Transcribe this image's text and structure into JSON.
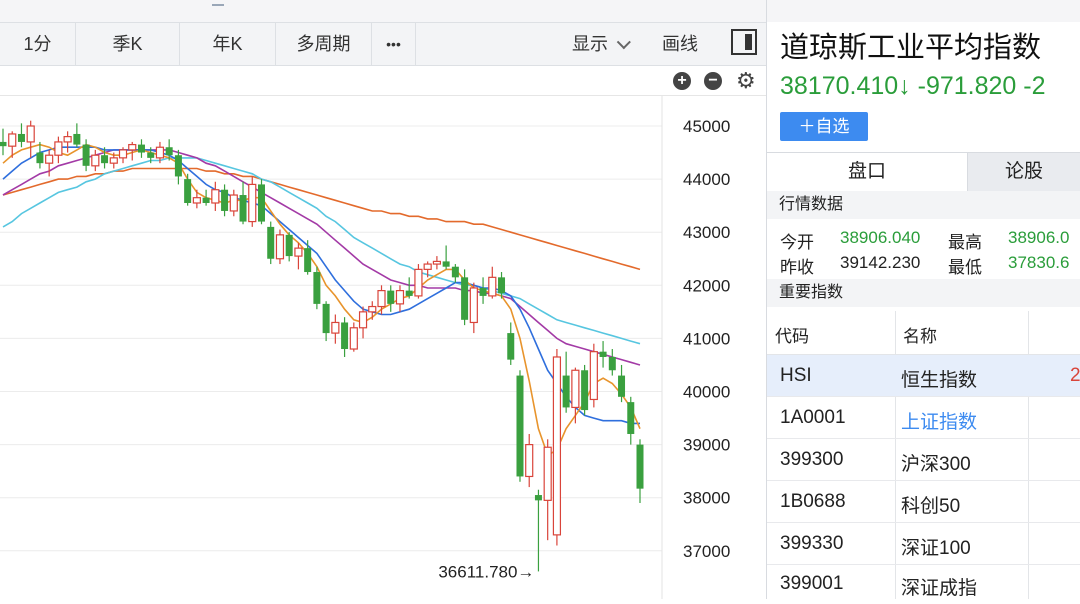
{
  "top_strip": {
    "marker": "1"
  },
  "toolbar": {
    "btn_1min": "1分",
    "btn_quarter": "季K",
    "btn_year": "年K",
    "btn_multi": "多周期",
    "btn_more": "•••",
    "display": "显示",
    "draw": "画线"
  },
  "chart_controls": {
    "zoom_in": "+",
    "zoom_out": "−",
    "settings": "⚙"
  },
  "quote": {
    "title": "道琼斯工业平均指数",
    "price": "38170.410",
    "arrow": "↓",
    "change": "-971.820",
    "change_pct": "-2",
    "add_watch": "＋自选"
  },
  "tabs": {
    "pankou": "盘口",
    "lungu": "论股"
  },
  "market_data": {
    "header": "行情数据",
    "open_label": "今开",
    "open": "38906.040",
    "high_label": "最高",
    "high": "38906.0",
    "prev_label": "昨收",
    "prev": "39142.230",
    "low_label": "最低",
    "low": "37830.6"
  },
  "indices": {
    "header": "重要指数",
    "col_code": "代码",
    "col_name": "名称",
    "rows": [
      {
        "code": "HSI",
        "name": "恒生指数",
        "extra": "2"
      },
      {
        "code": "1A0001",
        "name": "上证指数",
        "extra": ""
      },
      {
        "code": "399300",
        "name": "沪深300",
        "extra": ""
      },
      {
        "code": "1B0688",
        "name": "科创50",
        "extra": ""
      },
      {
        "code": "399330",
        "name": "深证100",
        "extra": ""
      },
      {
        "code": "399001",
        "name": "深证成指",
        "extra": ""
      }
    ]
  },
  "chart_data": {
    "type": "candlestick",
    "y_ticks": [
      "45000",
      "44000",
      "43000",
      "42000",
      "41000",
      "40000",
      "39000",
      "38000",
      "37000"
    ],
    "ylim": [
      36300,
      46500
    ],
    "annotation": "36611.780→",
    "low_marker_value": 36611.78,
    "colors": {
      "up": "#d9443a",
      "down": "#3aa03f",
      "ma5": "#e8942c",
      "ma10": "#2f6fdd",
      "ma20": "#a33aa6",
      "ma30": "#57c6e0",
      "ma60": "#e36a2c"
    },
    "candles": [
      [
        44700,
        44950,
        44450,
        44620
      ],
      [
        44620,
        44900,
        44400,
        44850
      ],
      [
        44850,
        45050,
        44600,
        44700
      ],
      [
        44700,
        45100,
        44400,
        45000
      ],
      [
        44500,
        44700,
        44200,
        44300
      ],
      [
        44300,
        44550,
        44050,
        44450
      ],
      [
        44450,
        44800,
        44300,
        44700
      ],
      [
        44700,
        44900,
        44500,
        44800
      ],
      [
        44850,
        45050,
        44600,
        44650
      ],
      [
        44650,
        44750,
        44150,
        44250
      ],
      [
        44250,
        44550,
        44150,
        44450
      ],
      [
        44450,
        44600,
        44200,
        44300
      ],
      [
        44300,
        44500,
        44200,
        44400
      ],
      [
        44400,
        44600,
        44300,
        44550
      ],
      [
        44550,
        44700,
        44350,
        44650
      ],
      [
        44650,
        44750,
        44400,
        44500
      ],
      [
        44500,
        44600,
        44300,
        44400
      ],
      [
        44400,
        44700,
        44300,
        44600
      ],
      [
        44600,
        44750,
        44350,
        44450
      ],
      [
        44450,
        44550,
        43900,
        44050
      ],
      [
        44000,
        44100,
        43500,
        43550
      ],
      [
        43550,
        43800,
        43450,
        43650
      ],
      [
        43650,
        43800,
        43500,
        43550
      ],
      [
        43550,
        43950,
        43400,
        43800
      ],
      [
        43800,
        43900,
        43300,
        43400
      ],
      [
        43400,
        43800,
        43300,
        43700
      ],
      [
        43700,
        43950,
        43150,
        43200
      ],
      [
        43200,
        44050,
        43100,
        43900
      ],
      [
        43900,
        44000,
        43150,
        43200
      ],
      [
        43100,
        43200,
        42400,
        42500
      ],
      [
        42500,
        43050,
        42400,
        42950
      ],
      [
        42950,
        43000,
        42450,
        42550
      ],
      [
        42550,
        42800,
        42300,
        42700
      ],
      [
        42700,
        42850,
        42200,
        42250
      ],
      [
        42250,
        42350,
        41550,
        41650
      ],
      [
        41650,
        41700,
        40950,
        41100
      ],
      [
        41100,
        41450,
        40900,
        41300
      ],
      [
        41300,
        41400,
        40650,
        40800
      ],
      [
        40800,
        41300,
        40750,
        41200
      ],
      [
        41200,
        41600,
        41000,
        41500
      ],
      [
        41500,
        41700,
        41350,
        41600
      ],
      [
        41600,
        42000,
        41450,
        41900
      ],
      [
        41900,
        42000,
        41500,
        41650
      ],
      [
        41650,
        42000,
        41500,
        41900
      ],
      [
        41900,
        42150,
        41750,
        41800
      ],
      [
        41800,
        42400,
        41750,
        42300
      ],
      [
        42300,
        42450,
        42150,
        42400
      ],
      [
        42400,
        42550,
        42300,
        42450
      ],
      [
        42450,
        42750,
        42300,
        42350
      ],
      [
        42350,
        42400,
        42050,
        42150
      ],
      [
        42150,
        42300,
        41250,
        41350
      ],
      [
        41300,
        42050,
        41100,
        41950
      ],
      [
        41950,
        42150,
        41650,
        41800
      ],
      [
        41800,
        42350,
        41750,
        42150
      ],
      [
        42150,
        42250,
        41750,
        41850
      ],
      [
        41100,
        41300,
        40500,
        40600
      ],
      [
        40300,
        40400,
        38300,
        38400
      ],
      [
        38400,
        39200,
        38200,
        39000
      ],
      [
        38050,
        38150,
        36611.78,
        37950
      ],
      [
        37950,
        39100,
        37200,
        38950
      ],
      [
        37300,
        40800,
        37100,
        40650
      ],
      [
        40300,
        40750,
        39600,
        39700
      ],
      [
        39700,
        40450,
        39400,
        40400
      ],
      [
        40400,
        40500,
        39550,
        39650
      ],
      [
        39850,
        40900,
        39700,
        40750
      ],
      [
        40750,
        40950,
        40450,
        40650
      ],
      [
        40650,
        40800,
        40300,
        40400
      ],
      [
        40300,
        40500,
        39800,
        39900
      ],
      [
        39800,
        39900,
        39000,
        39200
      ],
      [
        39000,
        39100,
        37900,
        38170.41
      ]
    ],
    "ma_lines": {
      "ma5": [
        44300,
        44450,
        44550,
        44600,
        44650,
        44600,
        44500,
        44450,
        44550,
        44650,
        44600,
        44500,
        44450,
        44450,
        44500,
        44550,
        44500,
        44450,
        44400,
        44300,
        44000,
        43750,
        43650,
        43600,
        43550,
        43600,
        43600,
        43650,
        43650,
        43400,
        43150,
        42950,
        42800,
        42600,
        42350,
        42000,
        41800,
        41550,
        41350,
        41300,
        41400,
        41550,
        41650,
        41750,
        41800,
        41950,
        42100,
        42200,
        42300,
        42300,
        42100,
        41950,
        41900,
        41850,
        41800,
        41550,
        41000,
        40200,
        39300,
        38800,
        38900,
        39300,
        39550,
        39800,
        40150,
        40250,
        40150,
        39950,
        39700,
        39300
      ],
      "ma10": [
        44000,
        44150,
        44300,
        44400,
        44500,
        44550,
        44600,
        44600,
        44600,
        44600,
        44600,
        44550,
        44550,
        44550,
        44550,
        44550,
        44550,
        44500,
        44450,
        44350,
        44200,
        44050,
        43900,
        43800,
        43750,
        43650,
        43600,
        43550,
        43500,
        43350,
        43200,
        43050,
        42900,
        42750,
        42600,
        42350,
        42100,
        41900,
        41700,
        41550,
        41500,
        41450,
        41450,
        41500,
        41550,
        41650,
        41750,
        41850,
        41950,
        42050,
        42050,
        42000,
        41950,
        41950,
        41900,
        41800,
        41550,
        41200,
        40800,
        40400,
        40150,
        39900,
        39700,
        39550,
        39500,
        39450,
        39450,
        39450,
        39400,
        39400
      ],
      "ma20": [
        43700,
        43800,
        43900,
        44000,
        44100,
        44150,
        44250,
        44300,
        44350,
        44400,
        44450,
        44500,
        44550,
        44550,
        44550,
        44550,
        44550,
        44550,
        44550,
        44500,
        44450,
        44400,
        44300,
        44250,
        44150,
        44050,
        43950,
        43850,
        43750,
        43650,
        43550,
        43450,
        43350,
        43250,
        43150,
        43000,
        42850,
        42700,
        42550,
        42400,
        42300,
        42200,
        42100,
        42050,
        42000,
        42000,
        41950,
        41950,
        41950,
        41950,
        41900,
        41900,
        41850,
        41850,
        41800,
        41750,
        41600,
        41450,
        41300,
        41150,
        41000,
        40900,
        40850,
        40800,
        40750,
        40700,
        40650,
        40600,
        40550,
        40500
      ],
      "ma30": [
        43100,
        43200,
        43350,
        43450,
        43550,
        43650,
        43750,
        43800,
        43850,
        43950,
        44000,
        44100,
        44150,
        44200,
        44250,
        44300,
        44350,
        44350,
        44400,
        44400,
        44400,
        44400,
        44350,
        44300,
        44250,
        44200,
        44150,
        44100,
        44000,
        43950,
        43850,
        43750,
        43650,
        43550,
        43450,
        43300,
        43200,
        43050,
        42900,
        42800,
        42700,
        42600,
        42500,
        42400,
        42350,
        42250,
        42200,
        42150,
        42100,
        42050,
        42000,
        42000,
        41950,
        41900,
        41850,
        41800,
        41750,
        41650,
        41550,
        41450,
        41350,
        41300,
        41250,
        41200,
        41150,
        41100,
        41050,
        41000,
        40950,
        40900
      ],
      "ma60": [
        43700,
        43750,
        43800,
        43850,
        43900,
        43950,
        44000,
        44000,
        44050,
        44050,
        44100,
        44100,
        44150,
        44150,
        44200,
        44200,
        44200,
        44200,
        44200,
        44200,
        44200,
        44200,
        44150,
        44150,
        44100,
        44100,
        44050,
        44050,
        44000,
        43950,
        43900,
        43850,
        43800,
        43750,
        43700,
        43650,
        43600,
        43550,
        43500,
        43450,
        43400,
        43400,
        43350,
        43350,
        43300,
        43300,
        43250,
        43250,
        43200,
        43200,
        43200,
        43150,
        43150,
        43100,
        43050,
        43000,
        42950,
        42900,
        42850,
        42800,
        42750,
        42700,
        42650,
        42600,
        42550,
        42500,
        42450,
        42400,
        42350,
        42300
      ]
    }
  }
}
